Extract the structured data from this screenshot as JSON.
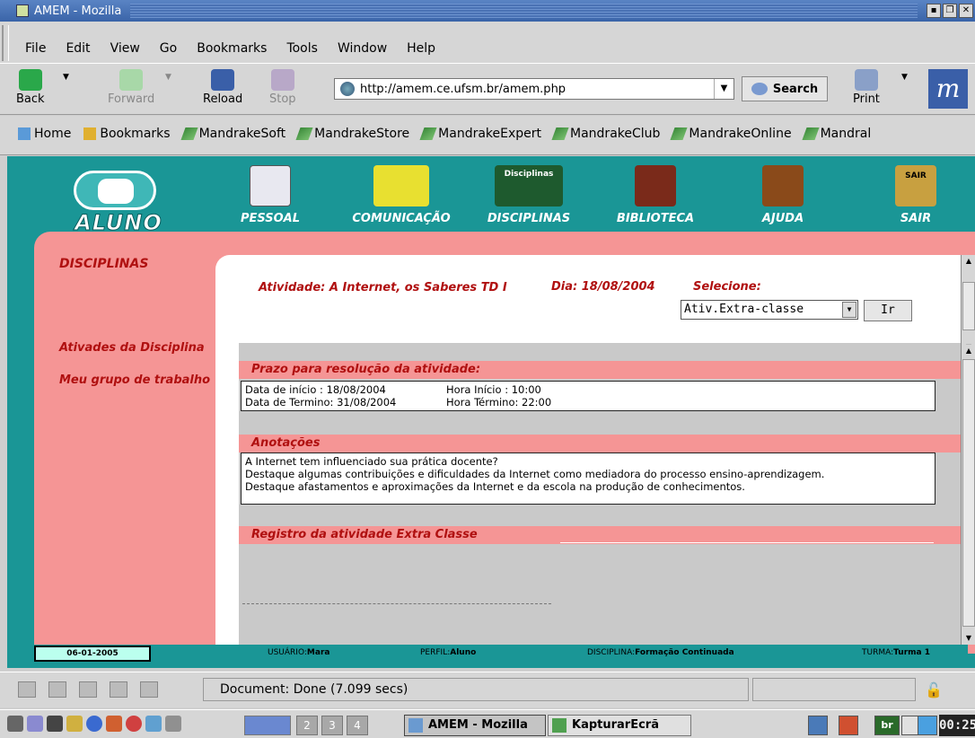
{
  "window": {
    "title": "AMEM - Mozilla"
  },
  "menu": [
    "File",
    "Edit",
    "View",
    "Go",
    "Bookmarks",
    "Tools",
    "Window",
    "Help"
  ],
  "toolbar": {
    "back": "Back",
    "forward": "Forward",
    "reload": "Reload",
    "stop": "Stop",
    "url": "http://amem.ce.ufsm.br/amem.php",
    "search": "Search",
    "print": "Print"
  },
  "personal_bar": [
    "Home",
    "Bookmarks",
    "MandrakeSoft",
    "MandrakeStore",
    "MandrakeExpert",
    "MandrakeClub",
    "MandrakeOnline",
    "Mandral"
  ],
  "site": {
    "logo": "ALUNO",
    "nav": [
      "PESSOAL",
      "COMUNICAÇÃO",
      "DISCIPLINAS",
      "BIBLIOTECA",
      "AJUDA",
      "SAIR"
    ],
    "nav_badges": {
      "disciplinas": "Disciplinas",
      "sair": "SAIR"
    },
    "sidebar": {
      "title": "DISCIPLINAS",
      "links": [
        "Ativades da Disciplina",
        "Meu grupo de trabalho"
      ]
    }
  },
  "activity": {
    "title": "Atividade: A Internet, os Saberes TD I",
    "day": "Dia: 18/08/2004",
    "select_label": "Selecione:",
    "select_value": "Ativ.Extra-classe",
    "go_button": "Ir"
  },
  "prazo": {
    "heading": "Prazo para resolução da atividade:",
    "start_date": "Data de início : 18/08/2004",
    "start_time": "Hora Início : 10:00",
    "end_date": "Data de Termino: 31/08/2004",
    "end_time": "Hora Término: 22:00"
  },
  "anotacoes": {
    "heading": "Anotações",
    "lines": [
      "A Internet tem influenciado sua prática docente?",
      "Destaque algumas contribuições e dificuldades da Internet como mediadora do processo ensino-aprendizagem.",
      "Destaque afastamentos e aproximações da Internet e da escola na produção de conhecimentos."
    ]
  },
  "registro": {
    "heading": "Registro da atividade Extra Classe"
  },
  "page_status": {
    "date": "06-01-2005",
    "usuario_label": "USUÁRIO:",
    "usuario": "Mara",
    "perfil_label": "PERFIL:",
    "perfil": "Aluno",
    "disciplina_label": "DISCIPLINA:",
    "disciplina": "Formação Continuada",
    "turma_label": "TURMA:",
    "turma": "Turma 1"
  },
  "browser_status": "Document: Done (7.099 secs)",
  "taskbar": {
    "desktops": [
      "2",
      "3",
      "4"
    ],
    "tasks": [
      "AMEM - Mozilla",
      "KapturarEcrã"
    ],
    "tray": [
      "br"
    ],
    "clock": "00:25"
  }
}
